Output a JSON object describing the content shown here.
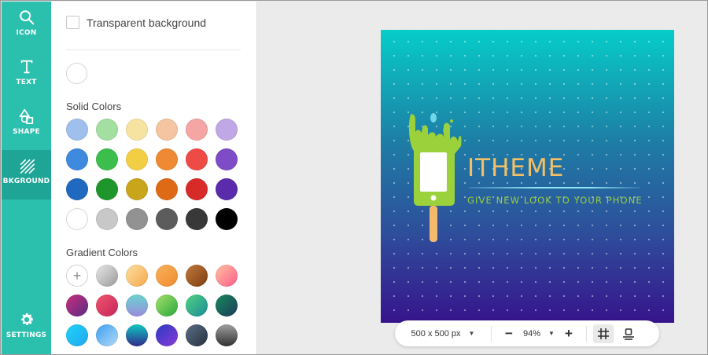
{
  "rail": {
    "icon": "ICON",
    "text": "TEXT",
    "shape": "SHAPE",
    "background": "BKGROUND",
    "settings": "SETTINGS"
  },
  "panel": {
    "transparent_label": "Transparent background",
    "solid_title": "Solid Colors",
    "gradient_title": "Gradient Colors",
    "solid_colors": [
      "#9fc0ec",
      "#a3dfa0",
      "#f7e3a1",
      "#f5c4a0",
      "#f4a5a4",
      "#c0a8e6",
      "#3d8ade",
      "#3cbe4c",
      "#f2ce45",
      "#f08934",
      "#ee4b46",
      "#7d4cc6",
      "#2069c0",
      "#1f962b",
      "#c9a51c",
      "#df6a15",
      "#d92a2a",
      "#5a2bab",
      "#ffffff",
      "#c8c8c8",
      "#929292",
      "#5c5c5c",
      "#383838",
      "#000000"
    ],
    "gradient_colors": [
      "add",
      "linear-gradient(135deg,#e8e8e8,#9a9a9a)",
      "linear-gradient(135deg,#fbe0a0,#f6a84b)",
      "linear-gradient(135deg,#f9b25a,#f08a2e)",
      "linear-gradient(135deg,#c0793a,#7d3e12)",
      "linear-gradient(135deg,#ffc3a0,#ff5a8a)",
      "linear-gradient(135deg,#c8307a,#5b2a86)",
      "linear-gradient(135deg,#f0566f,#c8245a)",
      "linear-gradient(180deg,#6ad4cf,#9a8cde)",
      "linear-gradient(135deg,#a7e06a,#27a83c)",
      "linear-gradient(135deg,#52d37e,#1a8a9a)",
      "linear-gradient(135deg,#178a5a,#1b3b5c)",
      "linear-gradient(135deg,#1fd4f7,#20a6f0)",
      "linear-gradient(135deg,#3ba0f0,#b3d9f7)",
      "linear-gradient(180deg,#0fc9c2,#2f2a8c)",
      "linear-gradient(135deg,#2a3bc4,#8a3ad6)",
      "linear-gradient(135deg,#5c6f86,#26303d)",
      "linear-gradient(180deg,#a0a0a0,#303030)"
    ]
  },
  "canvas": {
    "brand": "ITHEME",
    "tagline": "GIVE NEW LOOK TO YOUR PHONE"
  },
  "toolbar": {
    "size": "500 x 500 px",
    "zoom": "94%",
    "minus": "−",
    "plus": "+"
  },
  "icons": [
    "search-icon",
    "text-icon",
    "shape-icon",
    "background-icon",
    "settings-icon",
    "grid-icon",
    "align-bottom-icon"
  ]
}
